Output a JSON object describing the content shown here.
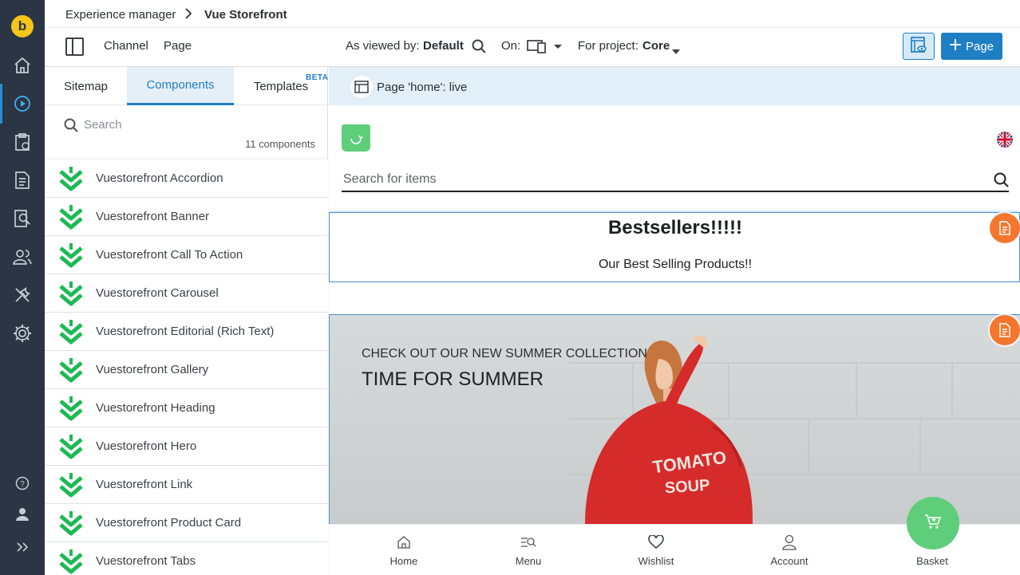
{
  "rail": {
    "logo_letter": "b",
    "icons": [
      "home-icon",
      "channels-icon",
      "projects-icon",
      "documents-icon",
      "content-reports-icon",
      "users-icon",
      "tools-icon",
      "settings-icon",
      "help-icon",
      "account-icon",
      "expand-icon"
    ]
  },
  "breadcrumb": {
    "parent": "Experience manager",
    "separator": ">",
    "current": "Vue Storefront"
  },
  "toolbar": {
    "channel": "Channel",
    "page": "Page",
    "viewed_by_label": "As viewed by:",
    "viewed_by_value": "Default",
    "on_label": "On:",
    "project_label": "For project:",
    "project_value": "Core",
    "add_page": "Page"
  },
  "sidebar": {
    "tabs": [
      {
        "label": "Sitemap",
        "active": false
      },
      {
        "label": "Components",
        "active": true
      },
      {
        "label": "Templates",
        "active": false
      }
    ],
    "beta": "BETA",
    "search_placeholder": "Search",
    "count": "11 components",
    "components": [
      "Vuestorefront Accordion",
      "Vuestorefront Banner",
      "Vuestorefront Call To Action",
      "Vuestorefront Carousel",
      "Vuestorefront Editorial (Rich Text)",
      "Vuestorefront Gallery",
      "Vuestorefront Heading",
      "Vuestorefront Hero",
      "Vuestorefront Link",
      "Vuestorefront Product Card",
      "Vuestorefront Tabs"
    ]
  },
  "preview": {
    "status": "Page 'home': live",
    "search_placeholder": "Search for items",
    "bestsellers_title": "Bestsellers!!!!!",
    "bestsellers_subtitle": "Our Best Selling Products!!",
    "hero_pretitle": "CHECK OUT OUR NEW SUMMER COLLECTION",
    "hero_title": "TIME FOR SUMMER",
    "shirt_line1": "TOMATO",
    "shirt_line2": "SOUP",
    "nav": [
      "Home",
      "Menu",
      "Wishlist",
      "Account",
      "Basket"
    ]
  },
  "colors": {
    "rail": "#2b3543",
    "accent": "#1f7fc4",
    "component_chevron": "#1db954",
    "edit_badge": "#f4762d",
    "store_green": "#5ece7b"
  }
}
